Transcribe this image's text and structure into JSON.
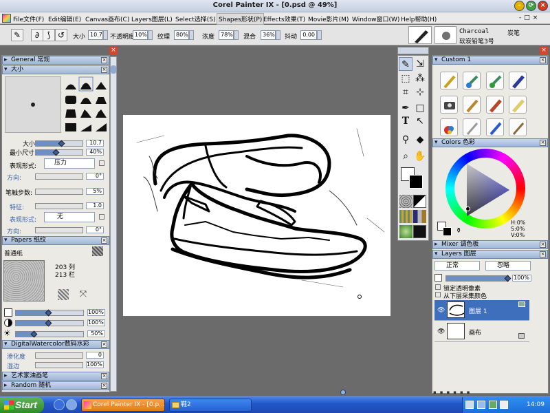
{
  "window": {
    "title": "Corel Painter IX - [0.psd @ 49%]"
  },
  "menu": [
    "File文件(F)",
    "Edit编辑(E)",
    "Canvas画布(C)",
    "Layers图层(L)",
    "Select选择(S)",
    "Shapes形状(P)",
    "Effects效果(T)",
    "Movie影片(M)",
    "Window窗口(W)",
    "Help帮助(H)"
  ],
  "propbar": {
    "size_label": "大小",
    "size": "10.7",
    "opacity_label": "不透明度",
    "opacity": "10%",
    "grain_label": "纹理",
    "grain": "80%",
    "resat_label": "浓度",
    "resat": "78%",
    "bleed_label": "混合",
    "bleed": "36%",
    "jitter_label": "抖动",
    "jitter": "0.00",
    "brush_category": "Charcoal",
    "brush_category_cn": "炭笔",
    "brush_variant": "软炭铅笔3号"
  },
  "left_panel": {
    "general_header": "General 常规",
    "size_header": "大小",
    "size_label": "大小:",
    "size_val": "10.7",
    "minsize_label": "最小尺寸:",
    "minsize_val": "40%",
    "expr_label": "表现形式:",
    "expr_val": "压力",
    "dir_label": "方向:",
    "dir_val": "0°",
    "step_label": "笔触步数:",
    "step_val": "5%",
    "feature_label": "特征:",
    "feature_val": "1.0",
    "expr2_label": "表现形式:",
    "expr2_val": "无",
    "dir2_label": "方向:",
    "dir2_val": "0°",
    "papers_header": "Papers 纸纹",
    "paper_name": "普通纸",
    "paper_cols": "203 列",
    "paper_rows": "213 栏",
    "paper_s1": "100%",
    "paper_s2": "100%",
    "paper_s3": "50%",
    "dw_header": "DigitalWatercolor数码水彩",
    "diffusion_label": "渗化度",
    "diffusion_val": "0",
    "wet_label": "湿边",
    "wet_val": "100%",
    "artist_header": "艺术家油画笔",
    "random_header": "Random 随机"
  },
  "right_panel": {
    "custom_header": "Custom 1",
    "colors_header": "Colors 色彩",
    "h": "H:0%",
    "s": "S:0%",
    "v": "V:0%",
    "mixer_header": "Mixer 调色板",
    "layers_header": "Layers 图层",
    "composite_method": "正常",
    "composite_depth": "忽略",
    "layer_opacity": "100%",
    "preserve": "锁定透明像素",
    "pick_under": "从下层采集颜色",
    "layers": [
      {
        "name": "图层 1",
        "selected": true
      },
      {
        "name": "画布",
        "selected": false
      }
    ]
  },
  "taskbar": {
    "start": "Start",
    "tasks": [
      "Corel Painter IX - [0.p...",
      "鞋2"
    ],
    "clock": "14:09"
  },
  "colors": {
    "accent": "#3d6fbd",
    "primary": "#ffffff",
    "secondary": "#000000"
  }
}
